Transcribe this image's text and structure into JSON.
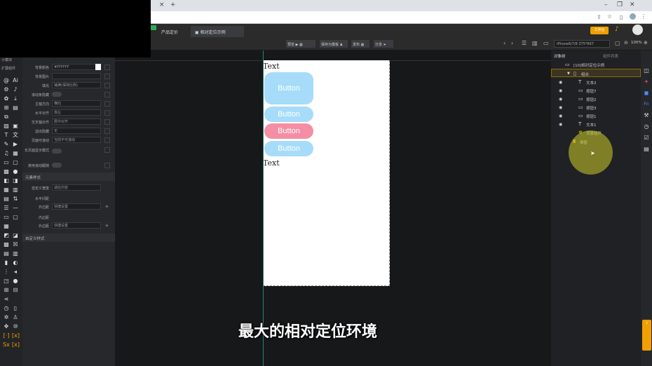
{
  "browser": {
    "tab_close": "×",
    "tab_new": "+",
    "win_buttons": [
      "–",
      "❐",
      "✕"
    ]
  },
  "header": {
    "tabs": [
      "产品定价",
      "相对定位示例"
    ],
    "badge": "工作台"
  },
  "toolbar": {
    "items": [
      "预览",
      "保存为模板",
      "发布",
      "分享"
    ],
    "device": "iPhone6/7/8 375*667",
    "zoom": "100%"
  },
  "left_icons": {
    "top_labels": [
      "小模块",
      "扩展组件"
    ]
  },
  "props": {
    "rows": [
      {
        "label": "背景颜色",
        "value": "#FFFFFF"
      },
      {
        "label": "背景图片",
        "value": ""
      },
      {
        "label": "填充",
        "value": "铺满(保持比例)"
      },
      {
        "label": "滚动条隐藏",
        "value": ""
      },
      {
        "label": "主轴方向",
        "value": "横向"
      },
      {
        "label": "水平对齐",
        "value": "靠左"
      },
      {
        "label": "交叉轴对齐",
        "value": "居中对齐"
      },
      {
        "label": "溢出隐藏",
        "value": "无"
      },
      {
        "label": "页面可滚动",
        "value": "当前不可滚动"
      },
      {
        "label": "长页面显示模式",
        "value": ""
      },
      {
        "label": "禁用滚动跟随",
        "value": ""
      }
    ],
    "section_layout": "元素样式",
    "layout_rows": [
      {
        "label": "自定义宽度",
        "value": "适应内容"
      },
      {
        "label": "水平间距",
        "value": ""
      },
      {
        "label": "外边距",
        "value": "快捷设置"
      },
      {
        "label": "内边距",
        "value": ""
      },
      {
        "label": "外边距",
        "value": "快捷设置"
      }
    ],
    "section_custom": "自定义样式"
  },
  "canvas": {
    "text_top": "Text",
    "text_bottom": "Text",
    "buttons": [
      "Button",
      "Button",
      "Button",
      "Button"
    ]
  },
  "right_panel": {
    "tabs": [
      "对象树",
      "组件列表"
    ],
    "page_title": "[10]相对定位示例",
    "group": "组合",
    "items": [
      {
        "icon": "T",
        "label": "文本2"
      },
      {
        "icon": "btn",
        "label": "按钮7"
      },
      {
        "icon": "btn",
        "label": "按钮2"
      },
      {
        "icon": "btn",
        "label": "按钮3"
      },
      {
        "icon": "btn",
        "label": "按钮1"
      },
      {
        "icon": "T",
        "label": "文本1"
      }
    ],
    "extra": [
      "背景组件",
      "弹窗"
    ]
  },
  "subtitle": "最大的相对定位环境",
  "colors": {
    "button_blue": "#a6dcf9",
    "button_pink": "#f48ea4",
    "accent_orange": "#f0a000",
    "guide_green": "#2d7f6e"
  }
}
